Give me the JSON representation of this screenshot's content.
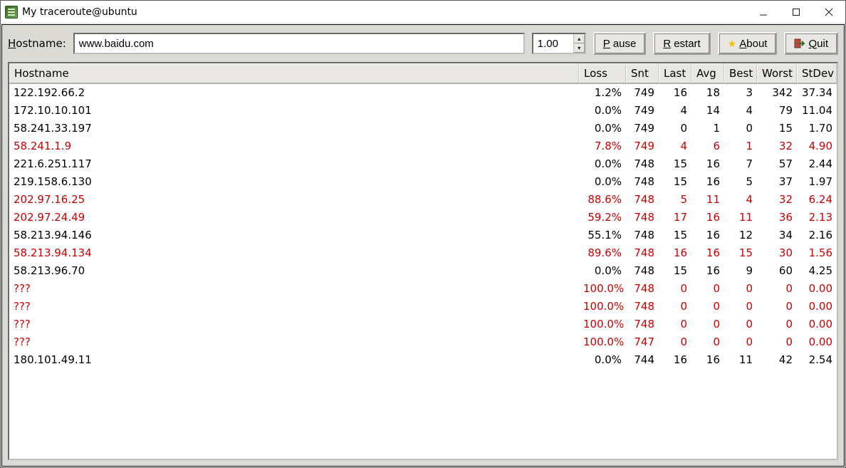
{
  "window": {
    "title": "My traceroute@ubuntu"
  },
  "toolbar": {
    "hostname_label_pre": "H",
    "hostname_label_post": "ostname:",
    "hostname_value": "www.baidu.com",
    "interval_value": "1.00",
    "pause_pre": "P",
    "pause_post": "ause",
    "restart_pre": "R",
    "restart_post": "estart",
    "about_pre": "A",
    "about_post": "bout",
    "quit_pre": "Q",
    "quit_post": "uit"
  },
  "columns": {
    "host": "Hostname",
    "loss": "Loss",
    "snt": "Snt",
    "last": "Last",
    "avg": "Avg",
    "best": "Best",
    "worst": "Worst",
    "stdev": "StDev"
  },
  "rows": [
    {
      "host": "122.192.66.2",
      "loss": "1.2%",
      "snt": "749",
      "last": "16",
      "avg": "18",
      "best": "3",
      "worst": "342",
      "stdev": "37.34",
      "red": false
    },
    {
      "host": "172.10.10.101",
      "loss": "0.0%",
      "snt": "749",
      "last": "4",
      "avg": "14",
      "best": "4",
      "worst": "79",
      "stdev": "11.04",
      "red": false
    },
    {
      "host": "58.241.33.197",
      "loss": "0.0%",
      "snt": "749",
      "last": "0",
      "avg": "1",
      "best": "0",
      "worst": "15",
      "stdev": "1.70",
      "red": false
    },
    {
      "host": "58.241.1.9",
      "loss": "7.8%",
      "snt": "749",
      "last": "4",
      "avg": "6",
      "best": "1",
      "worst": "32",
      "stdev": "4.90",
      "red": true
    },
    {
      "host": "221.6.251.117",
      "loss": "0.0%",
      "snt": "748",
      "last": "15",
      "avg": "16",
      "best": "7",
      "worst": "57",
      "stdev": "2.44",
      "red": false
    },
    {
      "host": "219.158.6.130",
      "loss": "0.0%",
      "snt": "748",
      "last": "15",
      "avg": "16",
      "best": "5",
      "worst": "37",
      "stdev": "1.97",
      "red": false
    },
    {
      "host": "202.97.16.25",
      "loss": "88.6%",
      "snt": "748",
      "last": "5",
      "avg": "11",
      "best": "4",
      "worst": "32",
      "stdev": "6.24",
      "red": true
    },
    {
      "host": "202.97.24.49",
      "loss": "59.2%",
      "snt": "748",
      "last": "17",
      "avg": "16",
      "best": "11",
      "worst": "36",
      "stdev": "2.13",
      "red": true
    },
    {
      "host": "58.213.94.146",
      "loss": "55.1%",
      "snt": "748",
      "last": "15",
      "avg": "16",
      "best": "12",
      "worst": "34",
      "stdev": "2.16",
      "red": false
    },
    {
      "host": "58.213.94.134",
      "loss": "89.6%",
      "snt": "748",
      "last": "16",
      "avg": "16",
      "best": "15",
      "worst": "30",
      "stdev": "1.56",
      "red": true
    },
    {
      "host": "58.213.96.70",
      "loss": "0.0%",
      "snt": "748",
      "last": "15",
      "avg": "16",
      "best": "9",
      "worst": "60",
      "stdev": "4.25",
      "red": false
    },
    {
      "host": "???",
      "loss": "100.0%",
      "snt": "748",
      "last": "0",
      "avg": "0",
      "best": "0",
      "worst": "0",
      "stdev": "0.00",
      "red": true
    },
    {
      "host": "???",
      "loss": "100.0%",
      "snt": "748",
      "last": "0",
      "avg": "0",
      "best": "0",
      "worst": "0",
      "stdev": "0.00",
      "red": true
    },
    {
      "host": "???",
      "loss": "100.0%",
      "snt": "748",
      "last": "0",
      "avg": "0",
      "best": "0",
      "worst": "0",
      "stdev": "0.00",
      "red": true
    },
    {
      "host": "???",
      "loss": "100.0%",
      "snt": "747",
      "last": "0",
      "avg": "0",
      "best": "0",
      "worst": "0",
      "stdev": "0.00",
      "red": true
    },
    {
      "host": "180.101.49.11",
      "loss": "0.0%",
      "snt": "744",
      "last": "16",
      "avg": "16",
      "best": "11",
      "worst": "42",
      "stdev": "2.54",
      "red": false
    }
  ]
}
